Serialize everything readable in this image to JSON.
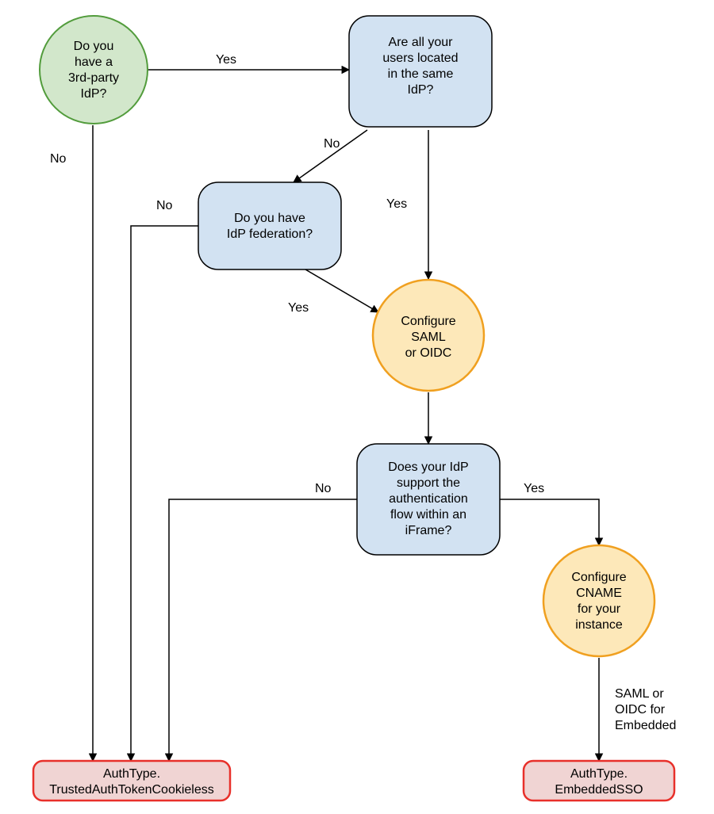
{
  "nodes": {
    "start": {
      "lines": [
        "Do you",
        "have a",
        "3rd-party",
        "IdP?"
      ]
    },
    "same_idp": {
      "lines": [
        "Are all your",
        "users located",
        "in the same",
        "IdP?"
      ]
    },
    "federation": {
      "lines": [
        "Do you have",
        "IdP federation?"
      ]
    },
    "configure_saml": {
      "lines": [
        "Configure",
        "SAML",
        "or OIDC"
      ]
    },
    "iframe": {
      "lines": [
        "Does your IdP",
        "support the",
        "authentication",
        "flow within an",
        "iFrame?"
      ]
    },
    "configure_cname": {
      "lines": [
        "Configure",
        "CNAME",
        "for your",
        "instance"
      ]
    },
    "trusted": {
      "lines": [
        "AuthType.",
        "TrustedAuthTokenCookieless"
      ]
    },
    "embedded": {
      "lines": [
        "AuthType.",
        "EmbeddedSSO"
      ]
    }
  },
  "labels": {
    "yes_start": "Yes",
    "no_start": "No",
    "no_same": "No",
    "yes_same": "Yes",
    "no_fed": "No",
    "yes_fed": "Yes",
    "no_iframe": "No",
    "yes_iframe": "Yes",
    "saml_embed_l1": "SAML or",
    "saml_embed_l2": "OIDC for",
    "saml_embed_l3": "Embedded"
  },
  "colors": {
    "green_fill": "#d2e7cb",
    "green_stroke": "#529c3c",
    "blue_fill": "#d2e2f2",
    "blue_stroke": "#000000",
    "orange_fill": "#fde8b9",
    "orange_stroke": "#f0a020",
    "red_fill": "#f0d4d3",
    "red_stroke": "#e8302a",
    "edge": "#000000"
  }
}
